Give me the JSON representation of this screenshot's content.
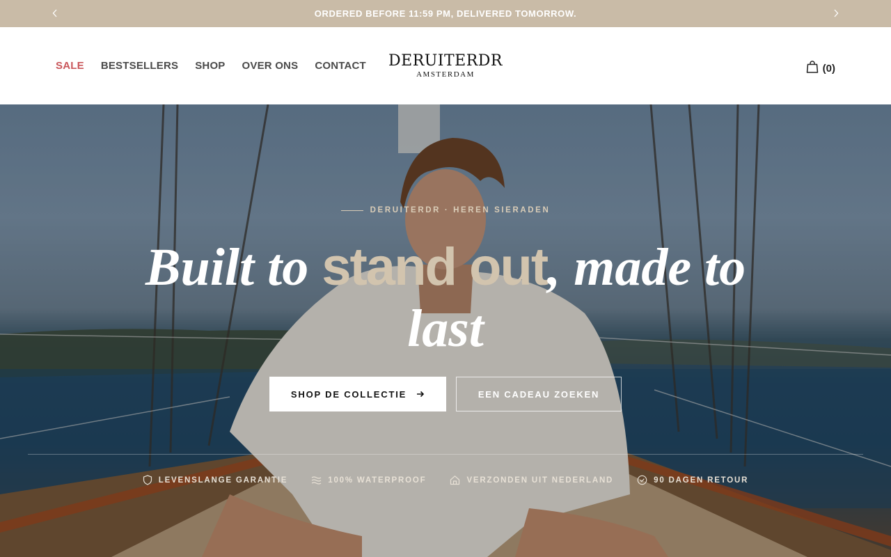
{
  "announcement": {
    "text": "ORDERED BEFORE 11:59 PM, DELIVERED TOMORROW.",
    "prev_icon": "chevron-left-icon",
    "next_icon": "chevron-right-icon"
  },
  "header": {
    "nav": [
      {
        "label": "SALE",
        "highlight": true
      },
      {
        "label": "BESTSELLERS"
      },
      {
        "label": "SHOP"
      },
      {
        "label": "OVER ONS"
      },
      {
        "label": "CONTACT"
      }
    ],
    "logo": {
      "main": "DERUITERDR",
      "sub": "AMSTERDAM"
    },
    "cart": {
      "icon": "shopping-bag-icon",
      "count": "(0)"
    }
  },
  "hero": {
    "eyebrow": "DERUITERDR · HEREN SIERADEN",
    "headline": {
      "part1": "Built to ",
      "accent": "stand out",
      "part2": ", made to last"
    },
    "cta_primary": "SHOP DE COLLECTIE",
    "cta_primary_icon": "arrow-right-icon",
    "cta_secondary": "EEN CADEAU ZOEKEN",
    "usps": [
      {
        "icon": "shield-icon",
        "label": "LEVENSLANGE GARANTIE"
      },
      {
        "icon": "waves-icon",
        "label": "100% WATERPROOF"
      },
      {
        "icon": "home-icon",
        "label": "VERZONDEN UIT NEDERLAND"
      },
      {
        "icon": "check-circle-icon",
        "label": "90 DAGEN RETOUR"
      }
    ]
  },
  "colors": {
    "announcement_bg": "#c9bba7",
    "sale": "#c9565a",
    "accent": "#d2c4ae"
  }
}
